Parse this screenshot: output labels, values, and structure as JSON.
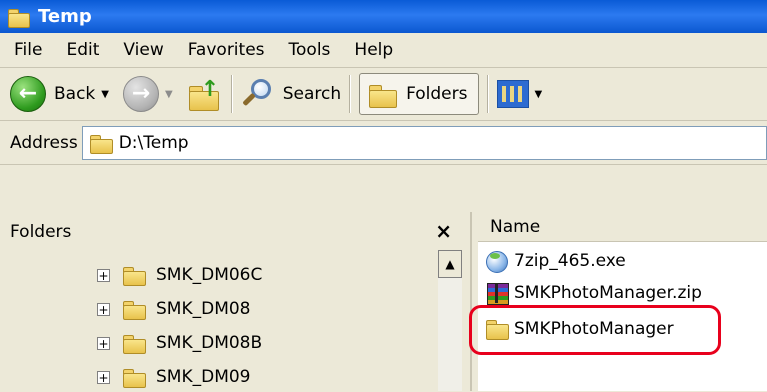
{
  "window": {
    "title": "Temp"
  },
  "menu": [
    "File",
    "Edit",
    "View",
    "Favorites",
    "Tools",
    "Help"
  ],
  "toolbar": {
    "back_label": "Back",
    "search_label": "Search",
    "folders_label": "Folders"
  },
  "address": {
    "label": "Address",
    "path": "D:\\Temp"
  },
  "folders_pane": {
    "title": "Folders",
    "close_glyph": "×",
    "items": [
      {
        "expander": "+",
        "label": "SMK_DM06C"
      },
      {
        "expander": "+",
        "label": "SMK_DM08"
      },
      {
        "expander": "+",
        "label": "SMK_DM08B"
      },
      {
        "expander": "+",
        "label": "SMK_DM09"
      }
    ]
  },
  "files_pane": {
    "column_name": "Name",
    "files": [
      {
        "name": "7zip_465.exe",
        "icon": "exe-installer-icon"
      },
      {
        "name": "SMKPhotoManager.zip",
        "icon": "zip-archive-icon"
      },
      {
        "name": "SMKPhotoManager",
        "icon": "folder-icon"
      }
    ]
  },
  "colors": {
    "titlebar": "#0A5BD6",
    "window_bg": "#ECE9D8",
    "highlight": "#E8001C"
  }
}
